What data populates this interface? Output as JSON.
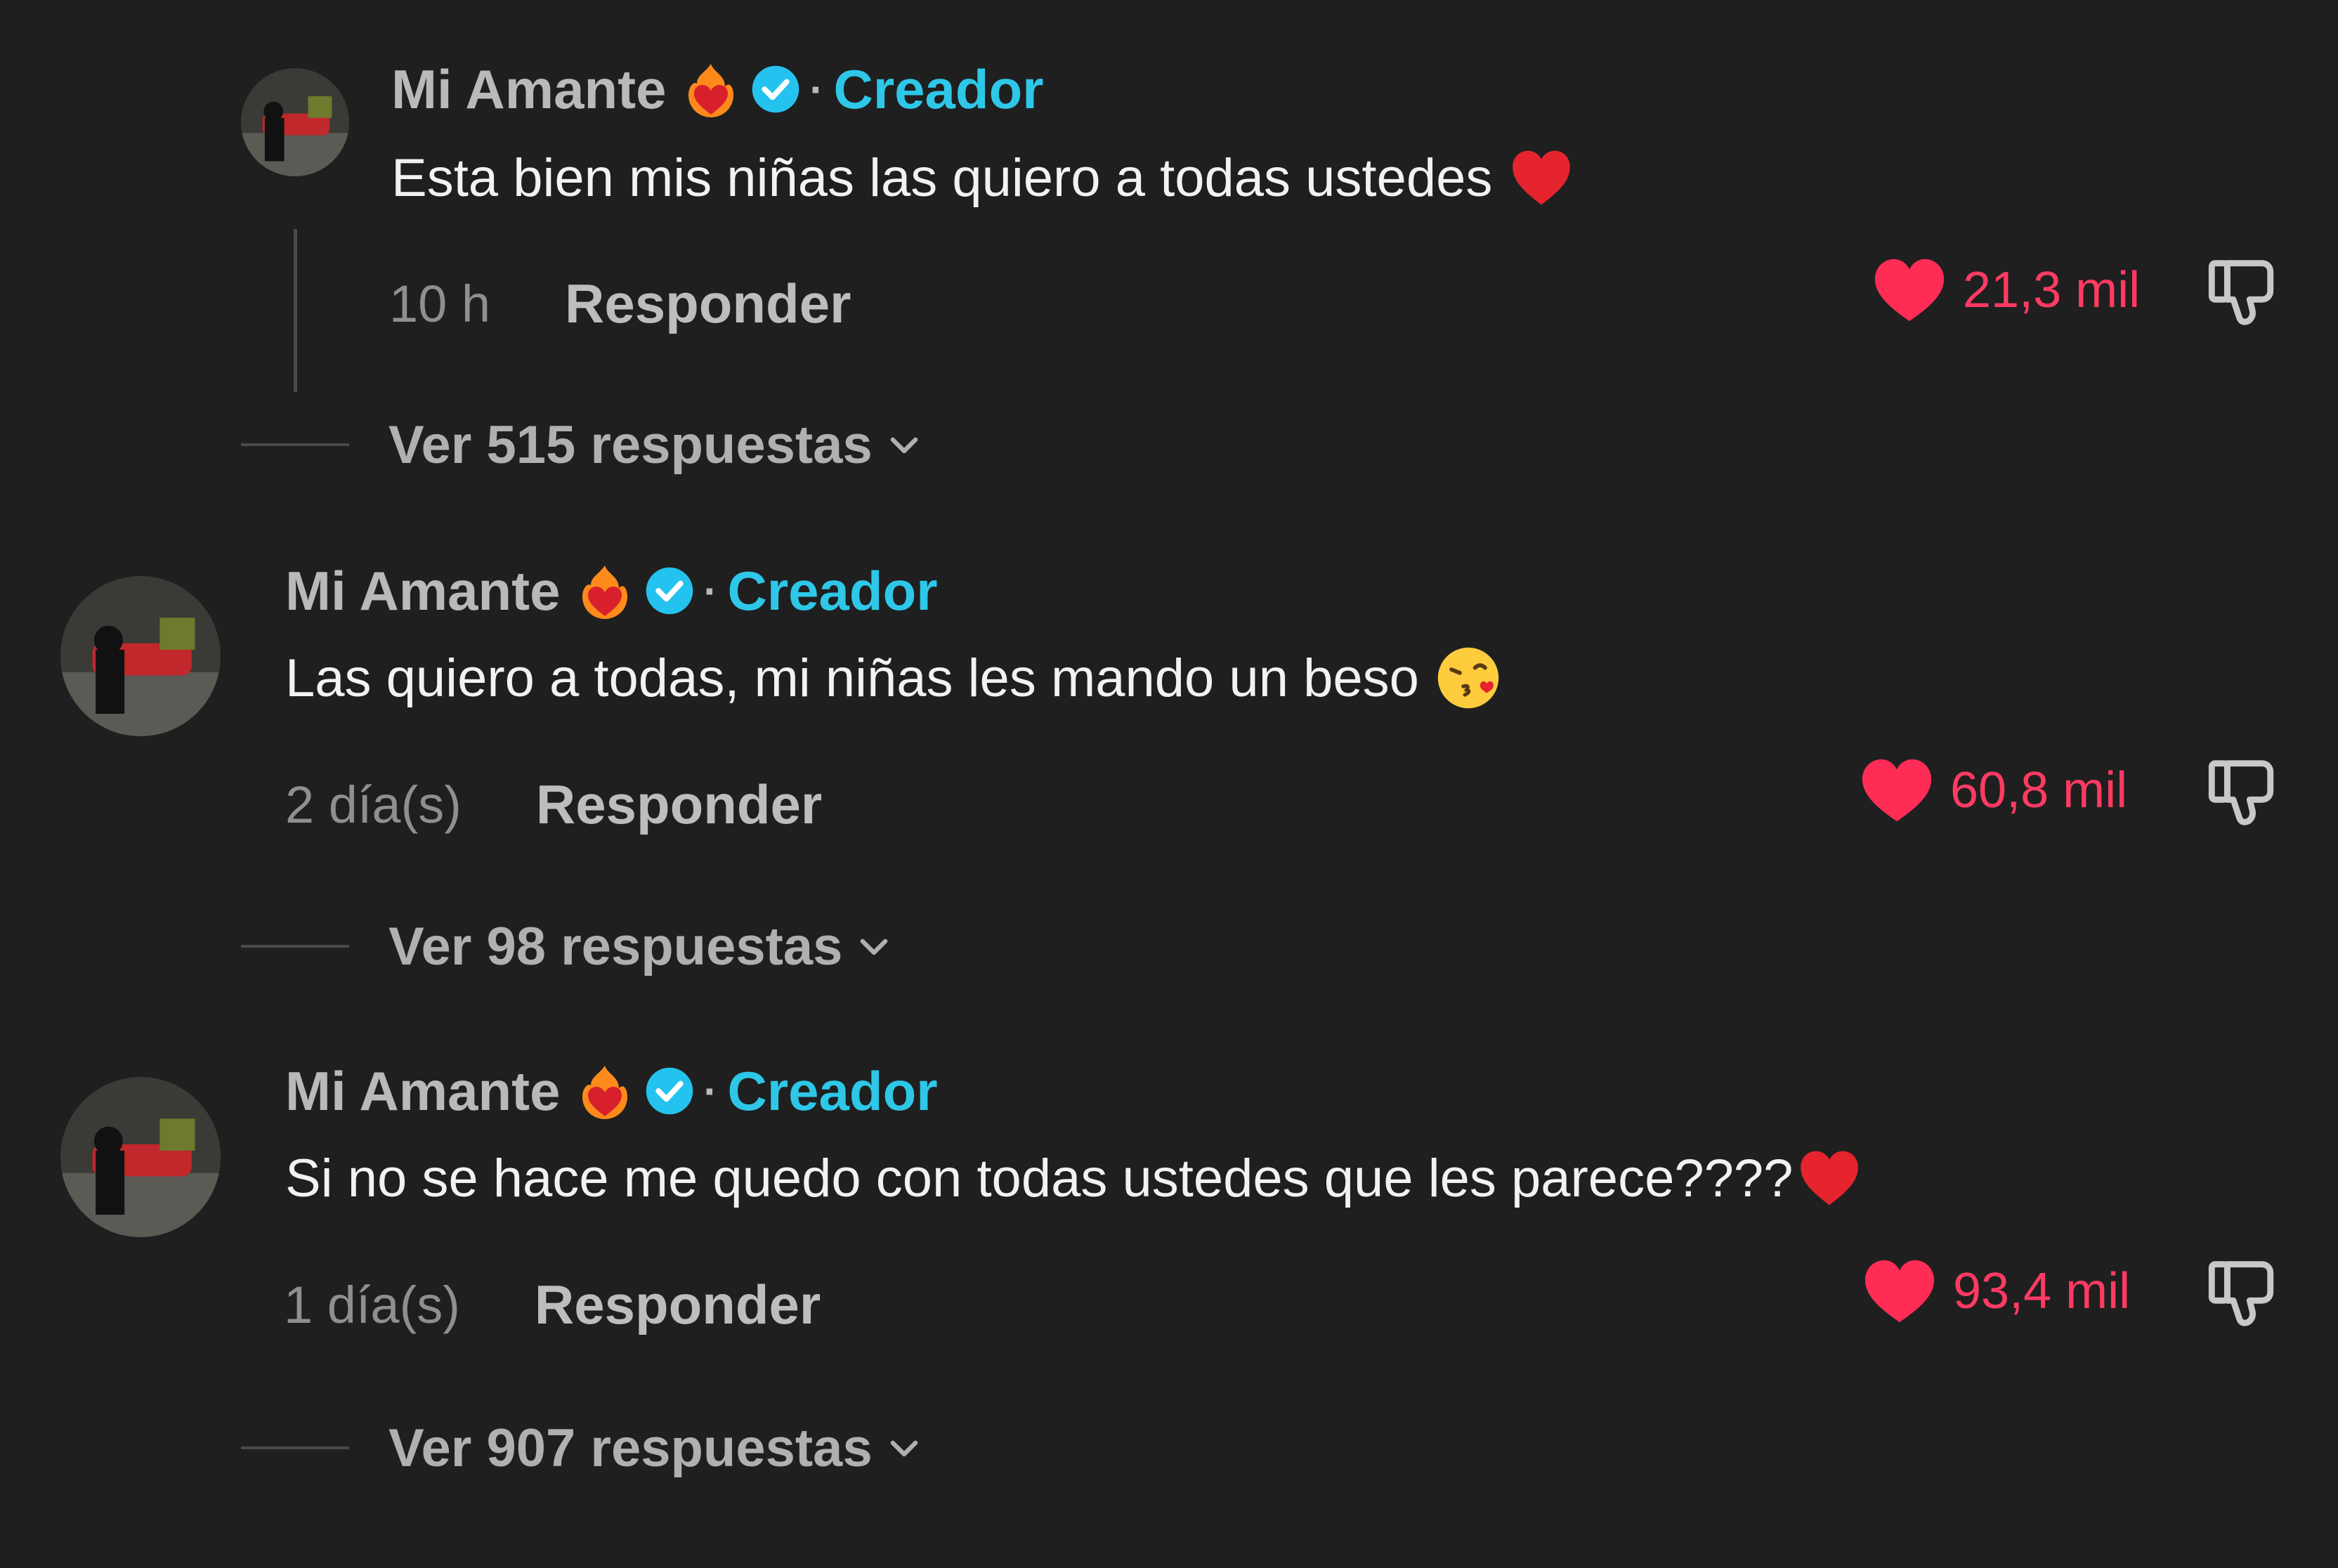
{
  "comments": [
    {
      "username": "Mi Amante",
      "creator_label": "Creador",
      "separator": "·",
      "text": "Esta bien mis niñas las quiero a todas ustedes",
      "emoji": "red-heart",
      "time": "10 h",
      "reply_label": "Responder",
      "likes": "21,3 mil",
      "replies_label": "Ver 515 respuestas"
    },
    {
      "username": "Mi Amante",
      "creator_label": "Creador",
      "separator": "·",
      "text": "Las quiero a todas, mi niñas les mando un beso",
      "emoji": "face-blowing-kiss",
      "time": "2 día(s)",
      "reply_label": "Responder",
      "likes": "60,8 mil",
      "replies_label": "Ver 98 respuestas"
    },
    {
      "username": "Mi Amante",
      "creator_label": "Creador",
      "separator": "·",
      "text": "Si no se hace me quedo con todas ustedes que les parece????",
      "emoji": "red-heart",
      "time": "1 día(s)",
      "reply_label": "Responder",
      "likes": "93,4 mil",
      "replies_label": "Ver 907 respuestas"
    }
  ],
  "colors": {
    "background": "#1f1f1f",
    "creator": "#2ec7e8",
    "like": "#ff3b63",
    "username": "#b9b9b9",
    "text": "#f2f2f2"
  },
  "icons": [
    "heart-fire-emoji",
    "verified-badge-icon",
    "heart-like-icon",
    "dislike-icon",
    "chevron-down-icon",
    "avatar"
  ]
}
